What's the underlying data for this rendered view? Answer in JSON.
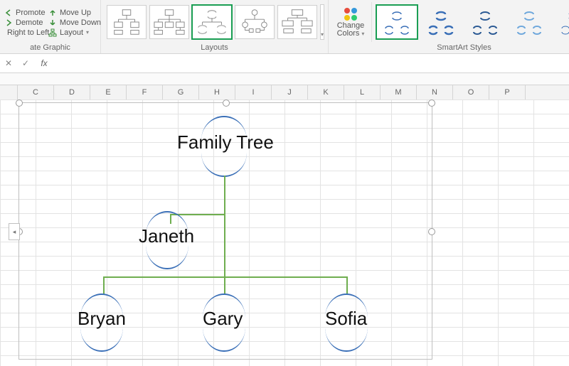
{
  "ribbon": {
    "create": {
      "promote": "Promote",
      "demote": "Demote",
      "rtl": "Right to Left",
      "label": "ate Graphic",
      "moveup": "Move Up",
      "movedown": "Move Down",
      "layoutbtn": "Layout"
    },
    "layouts": {
      "label": "Layouts"
    },
    "styles": {
      "changecolors": "Change",
      "changecolors2": "Colors",
      "label": "SmartArt Styles"
    }
  },
  "columns": [
    "C",
    "D",
    "E",
    "F",
    "G",
    "H",
    "I",
    "J",
    "K",
    "L",
    "M",
    "N",
    "O",
    "P"
  ],
  "smartart": {
    "root": "Family Tree",
    "level2": "Janeth",
    "leaves": [
      "Bryan",
      "Gary",
      "Sofia"
    ]
  },
  "chart_data": {
    "type": "table",
    "title": "Family Tree (SmartArt hierarchy)",
    "structure": {
      "name": "Family Tree",
      "children": [
        {
          "name": "Janeth",
          "children": []
        },
        {
          "name": "Bryan",
          "children": []
        },
        {
          "name": "Gary",
          "children": []
        },
        {
          "name": "Sofia",
          "children": []
        }
      ]
    }
  }
}
